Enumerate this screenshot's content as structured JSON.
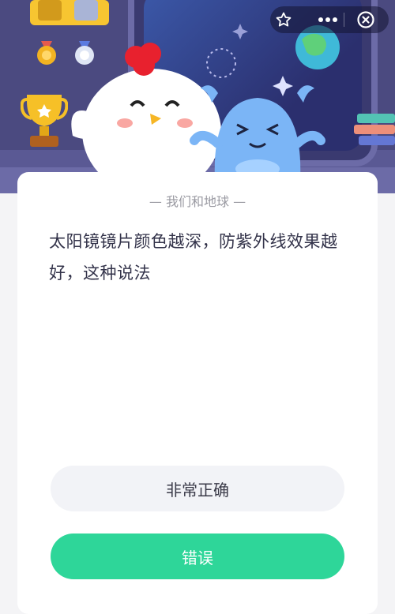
{
  "header": {
    "star_icon": "star-icon",
    "more_icon": "more-icon",
    "close_icon": "close-icon"
  },
  "card": {
    "subtitle": "我们和地球",
    "question": "太阳镜镜片颜色越深，防紫外线效果越好，这种说法",
    "options": [
      {
        "label": "非常正确"
      },
      {
        "label": "错误"
      }
    ]
  },
  "colors": {
    "hero_bg": "#4b4a80",
    "option_correct_green": "#2ed699",
    "option_neutral": "#f2f3f7"
  }
}
